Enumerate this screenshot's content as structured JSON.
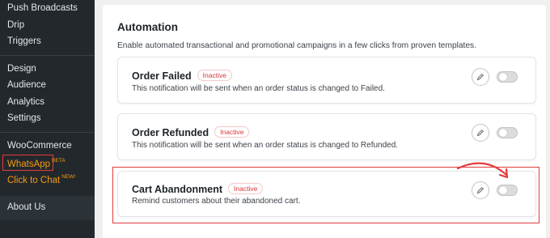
{
  "sidebar": {
    "items": [
      {
        "label": "Push Broadcasts"
      },
      {
        "label": "Drip"
      },
      {
        "label": "Triggers"
      },
      {
        "label": "Design"
      },
      {
        "label": "Audience"
      },
      {
        "label": "Analytics"
      },
      {
        "label": "Settings"
      },
      {
        "label": "WooCommerce"
      },
      {
        "label": "WhatsApp",
        "badge": "BETA"
      },
      {
        "label": "Click to Chat",
        "badge": "NEW!"
      },
      {
        "label": "About Us"
      }
    ]
  },
  "main": {
    "title": "Automation",
    "description": "Enable automated transactional and promotional campaigns in a few clicks from proven templates.",
    "cards": [
      {
        "title": "Order Failed",
        "status": "Inactive",
        "subtitle": "This notification will be sent when an order status is changed to Failed."
      },
      {
        "title": "Order Refunded",
        "status": "Inactive",
        "subtitle": "This notification will be sent when an order status is changed to Refunded."
      },
      {
        "title": "Cart Abandonment",
        "status": "Inactive",
        "subtitle": "Remind customers about their abandoned cart."
      }
    ]
  },
  "colors": {
    "sidebar_bg": "#23282d",
    "accent_orange": "#f39c12",
    "inactive_red": "#d63638",
    "highlight_red": "#e23c3c"
  },
  "icons": [
    "pencil-icon",
    "toggle-switch",
    "annotation-arrow"
  ]
}
